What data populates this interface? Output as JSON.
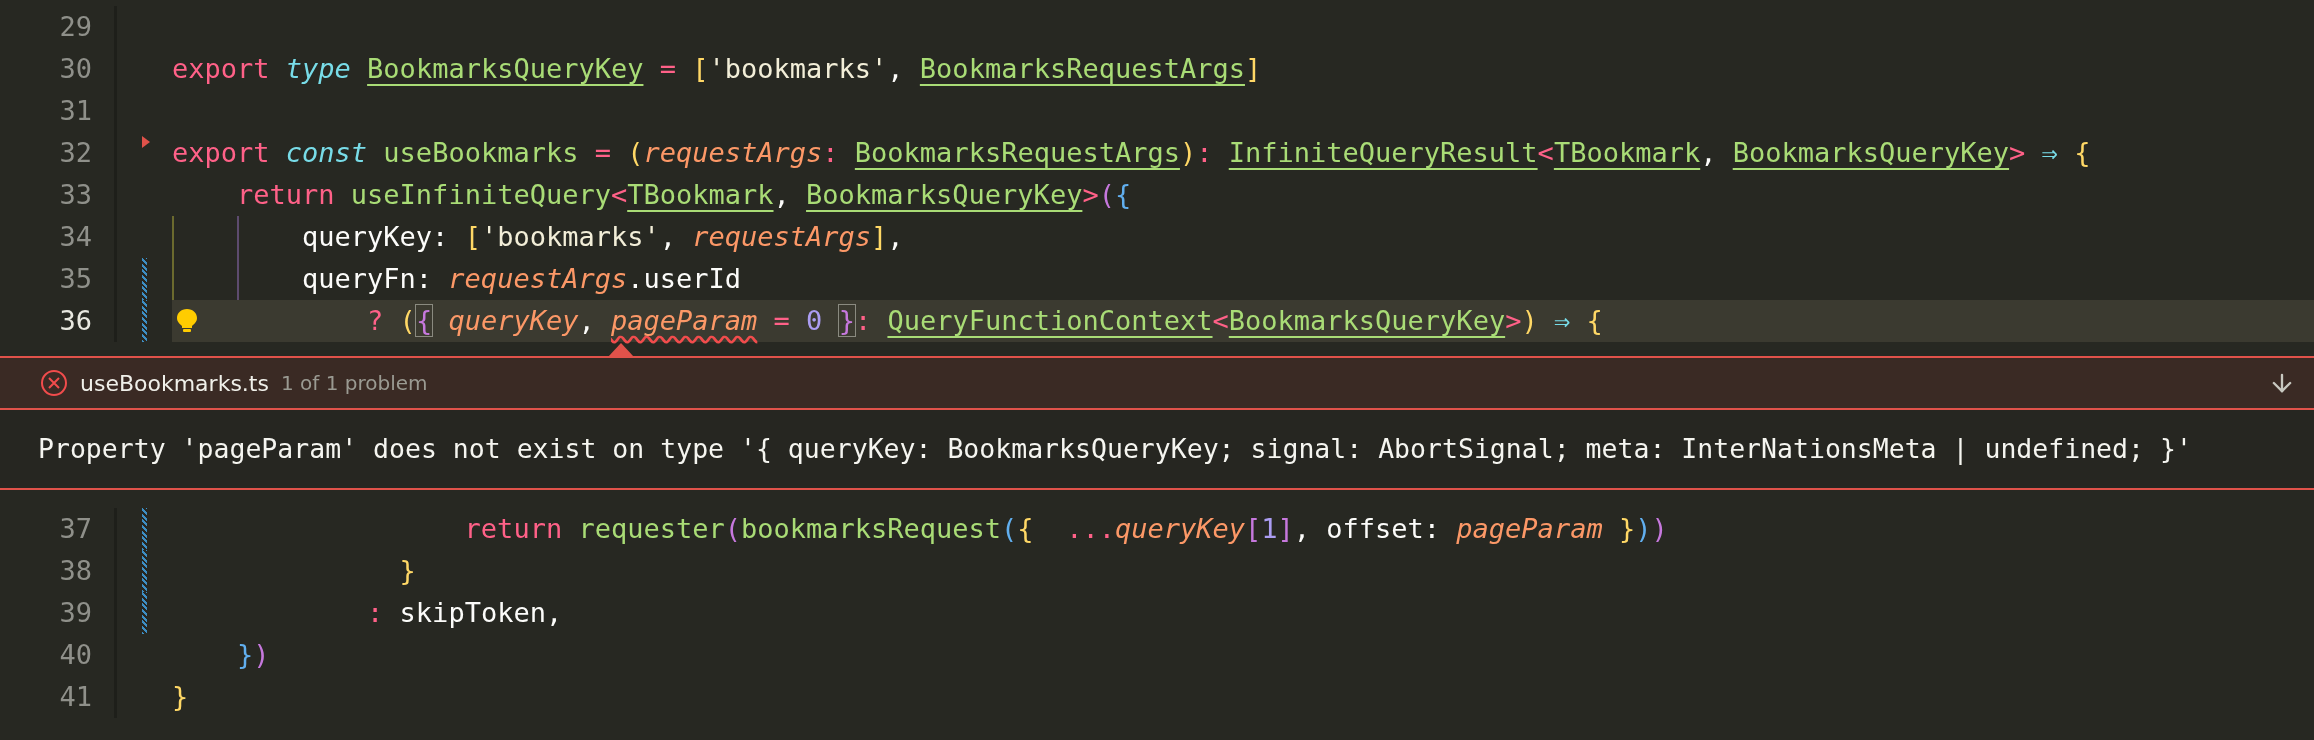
{
  "lines_above": [
    {
      "number": "29",
      "current": false,
      "modified": false,
      "marker": false,
      "lightbulb": false
    },
    {
      "number": "30",
      "current": false,
      "modified": false,
      "marker": false,
      "lightbulb": false,
      "tokens": [
        {
          "text": "export",
          "kind": "keyword"
        },
        {
          "text": " type",
          "kind": "storage"
        },
        {
          "text": " BookmarksQueryKey",
          "kind": "type"
        },
        {
          "text": " =",
          "kind": "operator"
        },
        {
          "text": " [",
          "kind": "bracket",
          "color": "#ffd866"
        },
        {
          "text": "'bookmarks'",
          "kind": "string"
        },
        {
          "text": ",",
          "kind": "text"
        },
        {
          "text": " BookmarksRequestArgs",
          "kind": "type"
        },
        {
          "text": "]",
          "kind": "bracket",
          "color": "#ffd866"
        }
      ]
    },
    {
      "number": "31",
      "current": false,
      "modified": false,
      "marker": false,
      "lightbulb": false
    },
    {
      "number": "32",
      "current": false,
      "modified": false,
      "marker": true,
      "lightbulb": false,
      "tokens": [
        {
          "text": "export",
          "kind": "keyword"
        },
        {
          "text": " const",
          "kind": "storage"
        },
        {
          "text": " useBookmarks",
          "kind": "function"
        },
        {
          "text": " =",
          "kind": "operator"
        },
        {
          "text": " (",
          "kind": "bracket",
          "color": "#ffd866"
        },
        {
          "text": "requestArgs",
          "kind": "parameter"
        },
        {
          "text": ":",
          "kind": "operator"
        },
        {
          "text": " BookmarksRequestArgs",
          "kind": "type"
        },
        {
          "text": ")",
          "kind": "bracket",
          "color": "#ffd866"
        },
        {
          "text": ":",
          "kind": "operator"
        },
        {
          "text": " InfiniteQueryResult",
          "kind": "type"
        },
        {
          "text": "<",
          "kind": "operator"
        },
        {
          "text": "TBookmark",
          "kind": "type"
        },
        {
          "text": ",",
          "kind": "text"
        },
        {
          "text": " BookmarksQueryKey",
          "kind": "type"
        },
        {
          "text": ">",
          "kind": "operator"
        },
        {
          "text": " ⇒",
          "kind": "arrow"
        },
        {
          "text": " {",
          "kind": "bracket",
          "color": "#ffd866"
        }
      ]
    },
    {
      "number": "33",
      "current": false,
      "modified": false,
      "marker": false,
      "lightbulb": false,
      "tokens": [
        {
          "text": "    return",
          "kind": "keyword"
        },
        {
          "text": " useInfiniteQuery",
          "kind": "function"
        },
        {
          "text": "<",
          "kind": "operator"
        },
        {
          "text": "TBookmark",
          "kind": "type"
        },
        {
          "text": ",",
          "kind": "text"
        },
        {
          "text": " BookmarksQueryKey",
          "kind": "type"
        },
        {
          "text": ">",
          "kind": "operator"
        },
        {
          "text": "(",
          "kind": "bracket",
          "color": "#c678dd"
        },
        {
          "text": "{",
          "kind": "bracket",
          "color": "#61afef"
        }
      ]
    },
    {
      "number": "34",
      "current": false,
      "modified": false,
      "marker": false,
      "lightbulb": false,
      "tokens": [
        {
          "text": "        queryKey:",
          "kind": "text"
        },
        {
          "text": " [",
          "kind": "bracket",
          "color": "#ffd866"
        },
        {
          "text": "'bookmarks'",
          "kind": "string"
        },
        {
          "text": ",",
          "kind": "text"
        },
        {
          "text": " requestArgs",
          "kind": "parameter"
        },
        {
          "text": "]",
          "kind": "bracket",
          "color": "#ffd866"
        },
        {
          "text": ",",
          "kind": "text"
        }
      ]
    },
    {
      "number": "35",
      "current": false,
      "modified": true,
      "marker": false,
      "lightbulb": false,
      "tokens": [
        {
          "text": "        queryFn:",
          "kind": "text"
        },
        {
          "text": " requestArgs",
          "kind": "parameter"
        },
        {
          "text": ".userId",
          "kind": "text"
        }
      ]
    },
    {
      "number": "36",
      "current": true,
      "modified": true,
      "marker": false,
      "lightbulb": true,
      "tokens": [
        {
          "text": "            ?",
          "kind": "operator"
        },
        {
          "text": " (",
          "kind": "bracket",
          "color": "#ffd866"
        },
        {
          "text": "{",
          "kind": "bracket",
          "color": "#c678dd",
          "matched": true
        },
        {
          "text": " queryKey",
          "kind": "parameter"
        },
        {
          "text": ",",
          "kind": "text"
        },
        {
          "text": " pageParam",
          "kind": "parameter",
          "error": true
        },
        {
          "text": " =",
          "kind": "operator"
        },
        {
          "text": " 0",
          "kind": "number"
        },
        {
          "text": " }",
          "kind": "bracket",
          "color": "#c678dd",
          "matched": true
        },
        {
          "text": ":",
          "kind": "operator"
        },
        {
          "text": " QueryFunctionContext",
          "kind": "type"
        },
        {
          "text": "<",
          "kind": "operator"
        },
        {
          "text": "BookmarksQueryKey",
          "kind": "type"
        },
        {
          "text": ">",
          "kind": "operator"
        },
        {
          "text": ")",
          "kind": "bracket",
          "color": "#ffd866"
        },
        {
          "text": " ⇒",
          "kind": "arrow"
        },
        {
          "text": " {",
          "kind": "bracket",
          "color": "#ffd866"
        }
      ]
    }
  ],
  "problem_peek": {
    "file": "useBookmarks.ts",
    "count": "1 of 1 problem",
    "message": "Property 'pageParam' does not exist on type '{ queryKey: BookmarksQueryKey; signal: AbortSignal; meta: InterNationsMeta | undefined; }'"
  },
  "lines_below": [
    {
      "number": "37",
      "current": false,
      "modified": true,
      "marker": false,
      "lightbulb": false,
      "tokens": [
        {
          "text": "                  return",
          "kind": "keyword"
        },
        {
          "text": " requester",
          "kind": "function"
        },
        {
          "text": "(",
          "kind": "bracket",
          "color": "#c678dd"
        },
        {
          "text": "bookmarksRequest",
          "kind": "function"
        },
        {
          "text": "(",
          "kind": "bracket",
          "color": "#61afef"
        },
        {
          "text": "{",
          "kind": "bracket",
          "color": "#ffd866"
        },
        {
          "text": "  ...",
          "kind": "operator"
        },
        {
          "text": "queryKey",
          "kind": "parameter"
        },
        {
          "text": "[",
          "kind": "bracket",
          "color": "#c678dd"
        },
        {
          "text": "1",
          "kind": "number"
        },
        {
          "text": "]",
          "kind": "bracket",
          "color": "#c678dd"
        },
        {
          "text": ", offset:",
          "kind": "text"
        },
        {
          "text": " pageParam",
          "kind": "parameter"
        },
        {
          "text": " }",
          "kind": "bracket",
          "color": "#ffd866"
        },
        {
          "text": ")",
          "kind": "bracket",
          "color": "#61afef"
        },
        {
          "text": ")",
          "kind": "bracket",
          "color": "#c678dd"
        }
      ]
    },
    {
      "number": "38",
      "current": false,
      "modified": true,
      "marker": false,
      "lightbulb": false,
      "tokens": [
        {
          "text": "              }",
          "kind": "bracket",
          "color": "#ffd866"
        }
      ]
    },
    {
      "number": "39",
      "current": false,
      "modified": true,
      "marker": false,
      "lightbulb": false,
      "tokens": [
        {
          "text": "            :",
          "kind": "operator"
        },
        {
          "text": " skipToken,",
          "kind": "text"
        }
      ]
    },
    {
      "number": "40",
      "current": false,
      "modified": false,
      "marker": false,
      "lightbulb": false,
      "tokens": [
        {
          "text": "    }",
          "kind": "bracket",
          "color": "#61afef"
        },
        {
          "text": ")",
          "kind": "bracket",
          "color": "#c678dd"
        }
      ]
    },
    {
      "number": "41",
      "current": false,
      "modified": false,
      "marker": false,
      "lightbulb": false,
      "tokens": [
        {
          "text": "}",
          "kind": "bracket",
          "color": "#ffd866"
        }
      ]
    }
  ]
}
